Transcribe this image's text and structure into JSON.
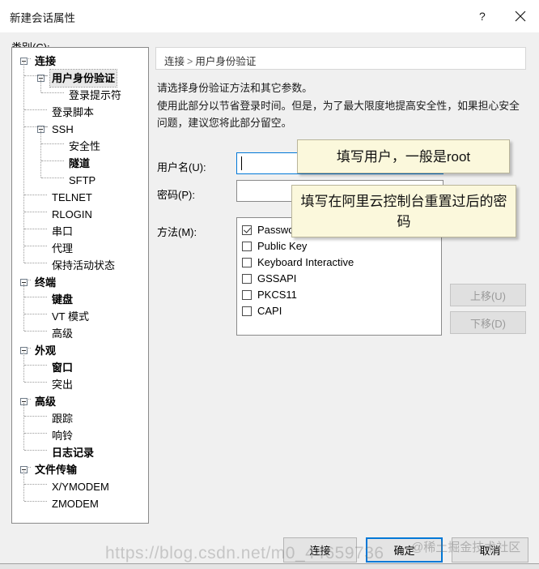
{
  "window": {
    "title": "新建会话属性",
    "help_icon": "question-mark-icon",
    "close_icon": "close-icon"
  },
  "category": {
    "label": "类别(C):",
    "tree": [
      {
        "label": "连接",
        "depth": 0,
        "bold": true,
        "expander": true,
        "selected": false
      },
      {
        "label": "用户身份验证",
        "depth": 1,
        "bold": true,
        "expander": true,
        "selected": true
      },
      {
        "label": "登录提示符",
        "depth": 2,
        "bold": false,
        "expander": false,
        "selected": false
      },
      {
        "label": "登录脚本",
        "depth": 1,
        "bold": false,
        "expander": false,
        "selected": false
      },
      {
        "label": "SSH",
        "depth": 1,
        "bold": false,
        "expander": true,
        "selected": false
      },
      {
        "label": "安全性",
        "depth": 2,
        "bold": false,
        "expander": false,
        "selected": false
      },
      {
        "label": "隧道",
        "depth": 2,
        "bold": true,
        "expander": false,
        "selected": false
      },
      {
        "label": "SFTP",
        "depth": 2,
        "bold": false,
        "expander": false,
        "selected": false
      },
      {
        "label": "TELNET",
        "depth": 1,
        "bold": false,
        "expander": false,
        "selected": false
      },
      {
        "label": "RLOGIN",
        "depth": 1,
        "bold": false,
        "expander": false,
        "selected": false
      },
      {
        "label": "串口",
        "depth": 1,
        "bold": false,
        "expander": false,
        "selected": false
      },
      {
        "label": "代理",
        "depth": 1,
        "bold": false,
        "expander": false,
        "selected": false
      },
      {
        "label": "保持活动状态",
        "depth": 1,
        "bold": false,
        "expander": false,
        "selected": false
      },
      {
        "label": "终端",
        "depth": 0,
        "bold": true,
        "expander": true,
        "selected": false
      },
      {
        "label": "键盘",
        "depth": 1,
        "bold": true,
        "expander": false,
        "selected": false
      },
      {
        "label": "VT 模式",
        "depth": 1,
        "bold": false,
        "expander": false,
        "selected": false
      },
      {
        "label": "高级",
        "depth": 1,
        "bold": false,
        "expander": false,
        "selected": false
      },
      {
        "label": "外观",
        "depth": 0,
        "bold": true,
        "expander": true,
        "selected": false
      },
      {
        "label": "窗口",
        "depth": 1,
        "bold": true,
        "expander": false,
        "selected": false
      },
      {
        "label": "突出",
        "depth": 1,
        "bold": false,
        "expander": false,
        "selected": false
      },
      {
        "label": "高级",
        "depth": 0,
        "bold": true,
        "expander": true,
        "selected": false
      },
      {
        "label": "跟踪",
        "depth": 1,
        "bold": false,
        "expander": false,
        "selected": false
      },
      {
        "label": "响铃",
        "depth": 1,
        "bold": false,
        "expander": false,
        "selected": false
      },
      {
        "label": "日志记录",
        "depth": 1,
        "bold": true,
        "expander": false,
        "selected": false
      },
      {
        "label": "文件传输",
        "depth": 0,
        "bold": true,
        "expander": true,
        "selected": false
      },
      {
        "label": "X/YMODEM",
        "depth": 1,
        "bold": false,
        "expander": false,
        "selected": false
      },
      {
        "label": "ZMODEM",
        "depth": 1,
        "bold": false,
        "expander": false,
        "selected": false
      }
    ]
  },
  "content": {
    "breadcrumb_root": "连接",
    "breadcrumb_sep": ">",
    "breadcrumb_current": "用户身份验证",
    "description_line1": "请选择身份验证方法和其它参数。",
    "description_line2": "使用此部分以节省登录时间。但是，为了最大限度地提高安全性，如果担心安全问题，建议您将此部分留空。",
    "username_label": "用户名(U):",
    "username_value": "",
    "password_label": "密码(P):",
    "password_value": "",
    "method_label": "方法(M):",
    "methods": [
      {
        "label": "Password",
        "checked": true
      },
      {
        "label": "Public Key",
        "checked": false
      },
      {
        "label": "Keyboard Interactive",
        "checked": false
      },
      {
        "label": "GSSAPI",
        "checked": false
      },
      {
        "label": "PKCS11",
        "checked": false
      },
      {
        "label": "CAPI",
        "checked": false
      }
    ],
    "move_up_label": "上移(U)",
    "move_down_label": "下移(D)"
  },
  "annotations": {
    "username_note": "填写用户，一般是root",
    "password_note": "填写在阿里云控制台重置过后的密码"
  },
  "footer": {
    "connect_label": "连接",
    "ok_label": "确定",
    "cancel_label": "取消"
  },
  "watermark": {
    "url": "https://blog.csdn.net/m0_44659736",
    "brand": "@稀土掘金技术社区"
  },
  "colors": {
    "accent": "#0078d7",
    "dialog_bg": "#f0f0f0",
    "annotation_bg": "#fbf8dc",
    "disabled_text": "#9a9a9a"
  }
}
